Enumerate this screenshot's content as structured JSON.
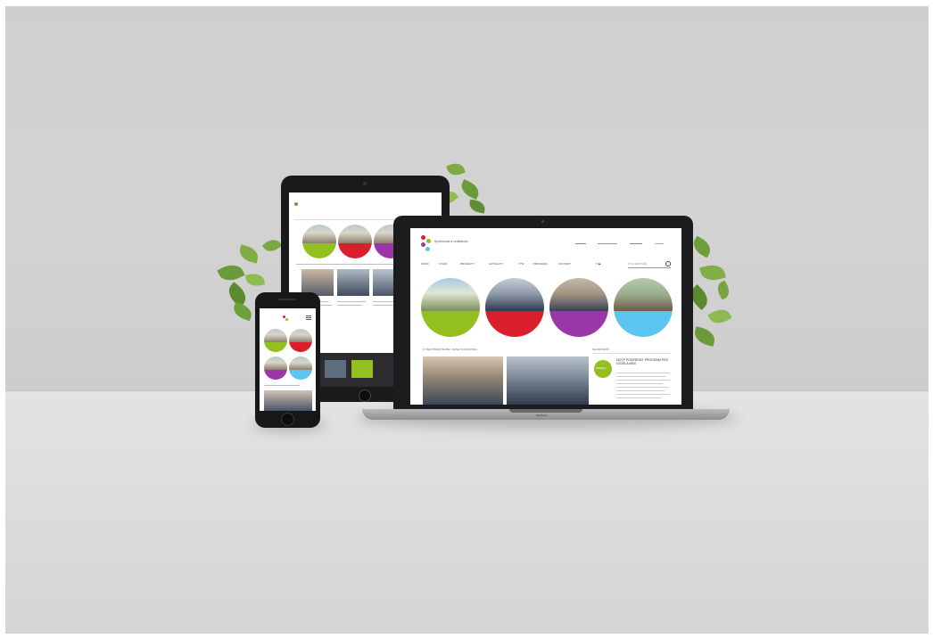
{
  "scene": {
    "colors": {
      "wall": "#cfcfcf",
      "desk": "#dedede",
      "device": "#1c1c1e",
      "leaf": "#6f9b3c"
    },
    "site": {
      "logo_text": "Společnost a vzdělávání",
      "nav": [
        "ÚVOD",
        "O NÁS",
        "PROJEKTY",
        "AKTUALITY",
        "TÝM",
        "PROGRAM",
        "KONTAKT"
      ],
      "search_placeholder": "VYHLEDÁVÁNÍ",
      "circle_colors": [
        "#93c01f",
        "#d81f2a",
        "#9b37a8",
        "#5bc5f2"
      ],
      "section_heading": "O ČEM PŘEMÝŠLÍME / NAŠE STANOVISKA",
      "side_heading": "NEJNOVĚJŠÍ",
      "badge_text": "NOVINKA",
      "article_title": "NOVÝ PODPŮRNÝ PROGRAM PRO VZDĚLÁVÁNÍ",
      "laptop_brand": "MacBook"
    }
  }
}
